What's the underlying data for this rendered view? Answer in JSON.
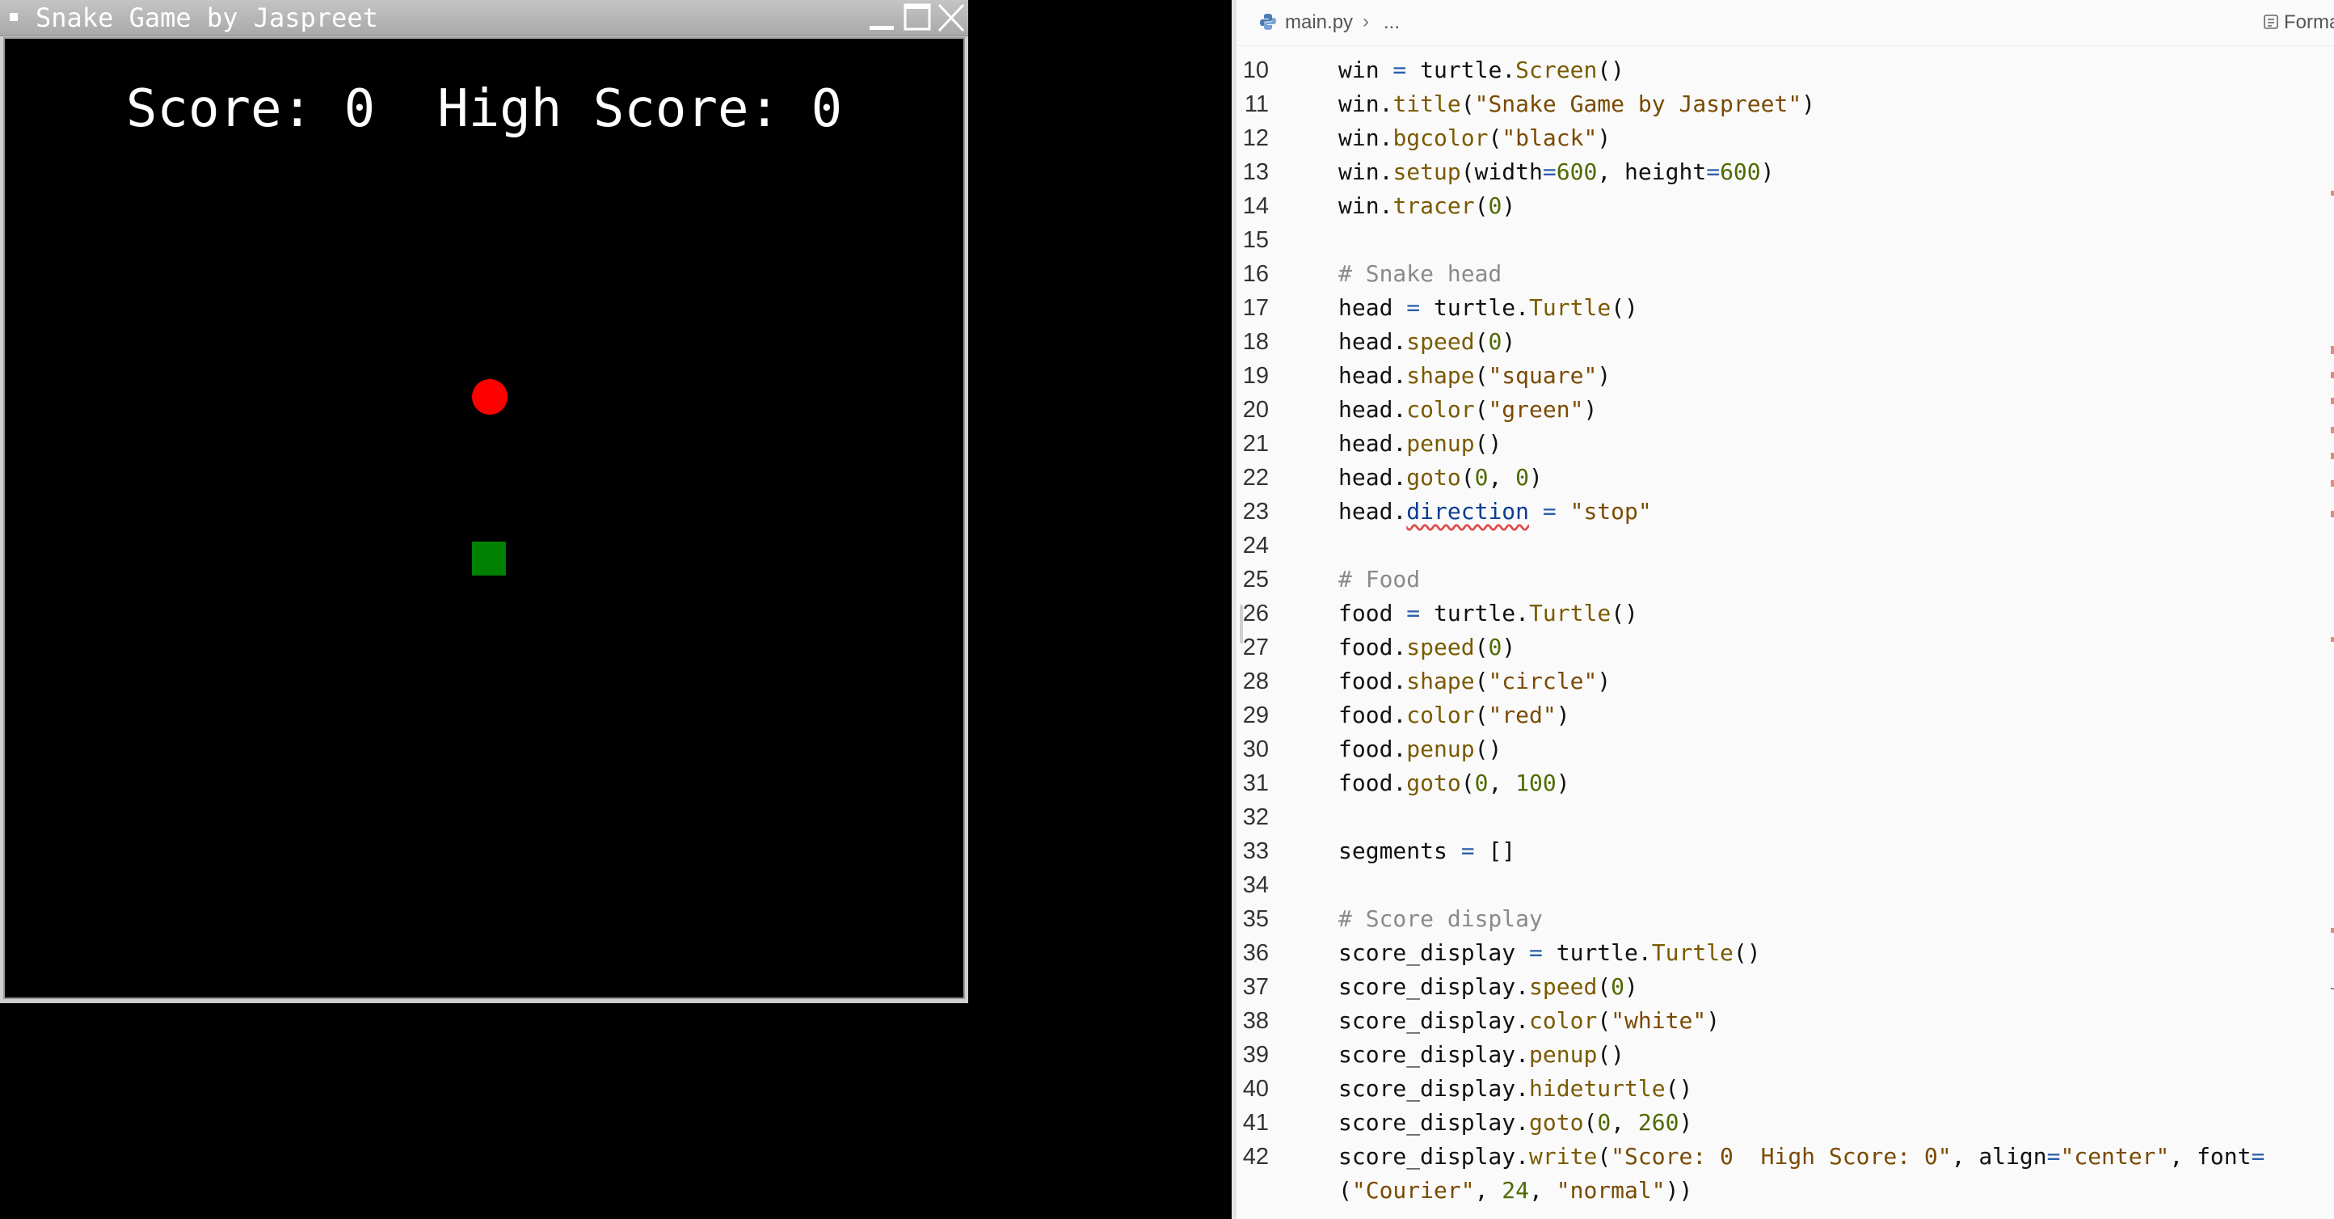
{
  "turtle_window": {
    "title": "Snake Game by Jaspreet",
    "score_text": "Score: 0  High Score: 0",
    "colors": {
      "background": "#000000",
      "food": "#ff0000",
      "snake_head": "#008000",
      "text": "#ffffff"
    }
  },
  "editor": {
    "breadcrumb": {
      "file": "main.py",
      "separator": "›",
      "more": "..."
    },
    "toolbar": {
      "format_label": "Forma"
    },
    "lines": [
      {
        "number": "10",
        "tokens": [
          [
            "name",
            "win"
          ],
          [
            "op",
            " = "
          ],
          [
            "name",
            "turtle"
          ],
          [
            "punct",
            "."
          ],
          [
            "method",
            "Screen"
          ],
          [
            "punct",
            "()"
          ]
        ]
      },
      {
        "number": "11",
        "tokens": [
          [
            "name",
            "win"
          ],
          [
            "punct",
            "."
          ],
          [
            "method",
            "title"
          ],
          [
            "punct",
            "("
          ],
          [
            "string",
            "\"Snake Game by Jaspreet\""
          ],
          [
            "punct",
            ")"
          ]
        ]
      },
      {
        "number": "12",
        "tokens": [
          [
            "name",
            "win"
          ],
          [
            "punct",
            "."
          ],
          [
            "method",
            "bgcolor"
          ],
          [
            "punct",
            "("
          ],
          [
            "string",
            "\"black\""
          ],
          [
            "punct",
            ")"
          ]
        ]
      },
      {
        "number": "13",
        "tokens": [
          [
            "name",
            "win"
          ],
          [
            "punct",
            "."
          ],
          [
            "method",
            "setup"
          ],
          [
            "punct",
            "("
          ],
          [
            "name",
            "width"
          ],
          [
            "op",
            "="
          ],
          [
            "number",
            "600"
          ],
          [
            "punct",
            ", "
          ],
          [
            "name",
            "height"
          ],
          [
            "op",
            "="
          ],
          [
            "number",
            "600"
          ],
          [
            "punct",
            ")"
          ]
        ]
      },
      {
        "number": "14",
        "tokens": [
          [
            "name",
            "win"
          ],
          [
            "punct",
            "."
          ],
          [
            "method",
            "tracer"
          ],
          [
            "punct",
            "("
          ],
          [
            "number",
            "0"
          ],
          [
            "punct",
            ")"
          ]
        ]
      },
      {
        "number": "15",
        "tokens": []
      },
      {
        "number": "16",
        "tokens": [
          [
            "comment",
            "# Snake head"
          ]
        ]
      },
      {
        "number": "17",
        "tokens": [
          [
            "name",
            "head"
          ],
          [
            "op",
            " = "
          ],
          [
            "name",
            "turtle"
          ],
          [
            "punct",
            "."
          ],
          [
            "method",
            "Turtle"
          ],
          [
            "punct",
            "()"
          ]
        ]
      },
      {
        "number": "18",
        "tokens": [
          [
            "name",
            "head"
          ],
          [
            "punct",
            "."
          ],
          [
            "method",
            "speed"
          ],
          [
            "punct",
            "("
          ],
          [
            "number",
            "0"
          ],
          [
            "punct",
            ")"
          ]
        ]
      },
      {
        "number": "19",
        "tokens": [
          [
            "name",
            "head"
          ],
          [
            "punct",
            "."
          ],
          [
            "method",
            "shape"
          ],
          [
            "punct",
            "("
          ],
          [
            "string",
            "\"square\""
          ],
          [
            "punct",
            ")"
          ]
        ]
      },
      {
        "number": "20",
        "tokens": [
          [
            "name",
            "head"
          ],
          [
            "punct",
            "."
          ],
          [
            "method",
            "color"
          ],
          [
            "punct",
            "("
          ],
          [
            "string",
            "\"green\""
          ],
          [
            "punct",
            ")"
          ]
        ]
      },
      {
        "number": "21",
        "tokens": [
          [
            "name",
            "head"
          ],
          [
            "punct",
            "."
          ],
          [
            "method",
            "penup"
          ],
          [
            "punct",
            "()"
          ]
        ]
      },
      {
        "number": "22",
        "tokens": [
          [
            "name",
            "head"
          ],
          [
            "punct",
            "."
          ],
          [
            "method",
            "goto"
          ],
          [
            "punct",
            "("
          ],
          [
            "number",
            "0"
          ],
          [
            "punct",
            ", "
          ],
          [
            "number",
            "0"
          ],
          [
            "punct",
            ")"
          ]
        ]
      },
      {
        "number": "23",
        "tokens": [
          [
            "name",
            "head"
          ],
          [
            "punct",
            "."
          ],
          [
            "error",
            "direction"
          ],
          [
            "op",
            " = "
          ],
          [
            "string",
            "\"stop\""
          ]
        ]
      },
      {
        "number": "24",
        "tokens": []
      },
      {
        "number": "25",
        "tokens": [
          [
            "comment",
            "# Food"
          ]
        ]
      },
      {
        "number": "26",
        "tokens": [
          [
            "name",
            "food"
          ],
          [
            "op",
            " = "
          ],
          [
            "name",
            "turtle"
          ],
          [
            "punct",
            "."
          ],
          [
            "method",
            "Turtle"
          ],
          [
            "punct",
            "()"
          ]
        ]
      },
      {
        "number": "27",
        "tokens": [
          [
            "name",
            "food"
          ],
          [
            "punct",
            "."
          ],
          [
            "method",
            "speed"
          ],
          [
            "punct",
            "("
          ],
          [
            "number",
            "0"
          ],
          [
            "punct",
            ")"
          ]
        ]
      },
      {
        "number": "28",
        "tokens": [
          [
            "name",
            "food"
          ],
          [
            "punct",
            "."
          ],
          [
            "method",
            "shape"
          ],
          [
            "punct",
            "("
          ],
          [
            "string",
            "\"circle\""
          ],
          [
            "punct",
            ")"
          ]
        ]
      },
      {
        "number": "29",
        "tokens": [
          [
            "name",
            "food"
          ],
          [
            "punct",
            "."
          ],
          [
            "method",
            "color"
          ],
          [
            "punct",
            "("
          ],
          [
            "string",
            "\"red\""
          ],
          [
            "punct",
            ")"
          ]
        ]
      },
      {
        "number": "30",
        "tokens": [
          [
            "name",
            "food"
          ],
          [
            "punct",
            "."
          ],
          [
            "method",
            "penup"
          ],
          [
            "punct",
            "()"
          ]
        ]
      },
      {
        "number": "31",
        "tokens": [
          [
            "name",
            "food"
          ],
          [
            "punct",
            "."
          ],
          [
            "method",
            "goto"
          ],
          [
            "punct",
            "("
          ],
          [
            "number",
            "0"
          ],
          [
            "punct",
            ", "
          ],
          [
            "number",
            "100"
          ],
          [
            "punct",
            ")"
          ]
        ]
      },
      {
        "number": "32",
        "tokens": []
      },
      {
        "number": "33",
        "tokens": [
          [
            "name",
            "segments"
          ],
          [
            "op",
            " = "
          ],
          [
            "punct",
            "[]"
          ]
        ]
      },
      {
        "number": "34",
        "tokens": []
      },
      {
        "number": "35",
        "tokens": [
          [
            "comment",
            "# Score display"
          ]
        ]
      },
      {
        "number": "36",
        "tokens": [
          [
            "name",
            "score_display"
          ],
          [
            "op",
            " = "
          ],
          [
            "name",
            "turtle"
          ],
          [
            "punct",
            "."
          ],
          [
            "method",
            "Turtle"
          ],
          [
            "punct",
            "()"
          ]
        ]
      },
      {
        "number": "37",
        "tokens": [
          [
            "name",
            "score_display"
          ],
          [
            "punct",
            "."
          ],
          [
            "method",
            "speed"
          ],
          [
            "punct",
            "("
          ],
          [
            "number",
            "0"
          ],
          [
            "punct",
            ")"
          ]
        ]
      },
      {
        "number": "38",
        "tokens": [
          [
            "name",
            "score_display"
          ],
          [
            "punct",
            "."
          ],
          [
            "method",
            "color"
          ],
          [
            "punct",
            "("
          ],
          [
            "string",
            "\"white\""
          ],
          [
            "punct",
            ")"
          ]
        ]
      },
      {
        "number": "39",
        "tokens": [
          [
            "name",
            "score_display"
          ],
          [
            "punct",
            "."
          ],
          [
            "method",
            "penup"
          ],
          [
            "punct",
            "()"
          ]
        ]
      },
      {
        "number": "40",
        "tokens": [
          [
            "name",
            "score_display"
          ],
          [
            "punct",
            "."
          ],
          [
            "method",
            "hideturtle"
          ],
          [
            "punct",
            "()"
          ]
        ]
      },
      {
        "number": "41",
        "tokens": [
          [
            "name",
            "score_display"
          ],
          [
            "punct",
            "."
          ],
          [
            "method",
            "goto"
          ],
          [
            "punct",
            "("
          ],
          [
            "number",
            "0"
          ],
          [
            "punct",
            ", "
          ],
          [
            "number",
            "260"
          ],
          [
            "punct",
            ")"
          ]
        ]
      },
      {
        "number": "42",
        "tokens": [
          [
            "name",
            "score_display"
          ],
          [
            "punct",
            "."
          ],
          [
            "method",
            "write"
          ],
          [
            "punct",
            "("
          ],
          [
            "string",
            "\"Score: 0  High Score: 0\""
          ],
          [
            "punct",
            ", "
          ],
          [
            "name",
            "align"
          ],
          [
            "op",
            "="
          ],
          [
            "string",
            "\"center\""
          ],
          [
            "punct",
            ", "
          ],
          [
            "name",
            "font"
          ],
          [
            "op",
            "="
          ]
        ]
      },
      {
        "number": "",
        "tokens": [
          [
            "punct",
            "("
          ],
          [
            "string",
            "\"Courier\""
          ],
          [
            "punct",
            ", "
          ],
          [
            "number",
            "24"
          ],
          [
            "punct",
            ", "
          ],
          [
            "string",
            "\"normal\""
          ],
          [
            "punct",
            "))"
          ]
        ]
      }
    ]
  }
}
